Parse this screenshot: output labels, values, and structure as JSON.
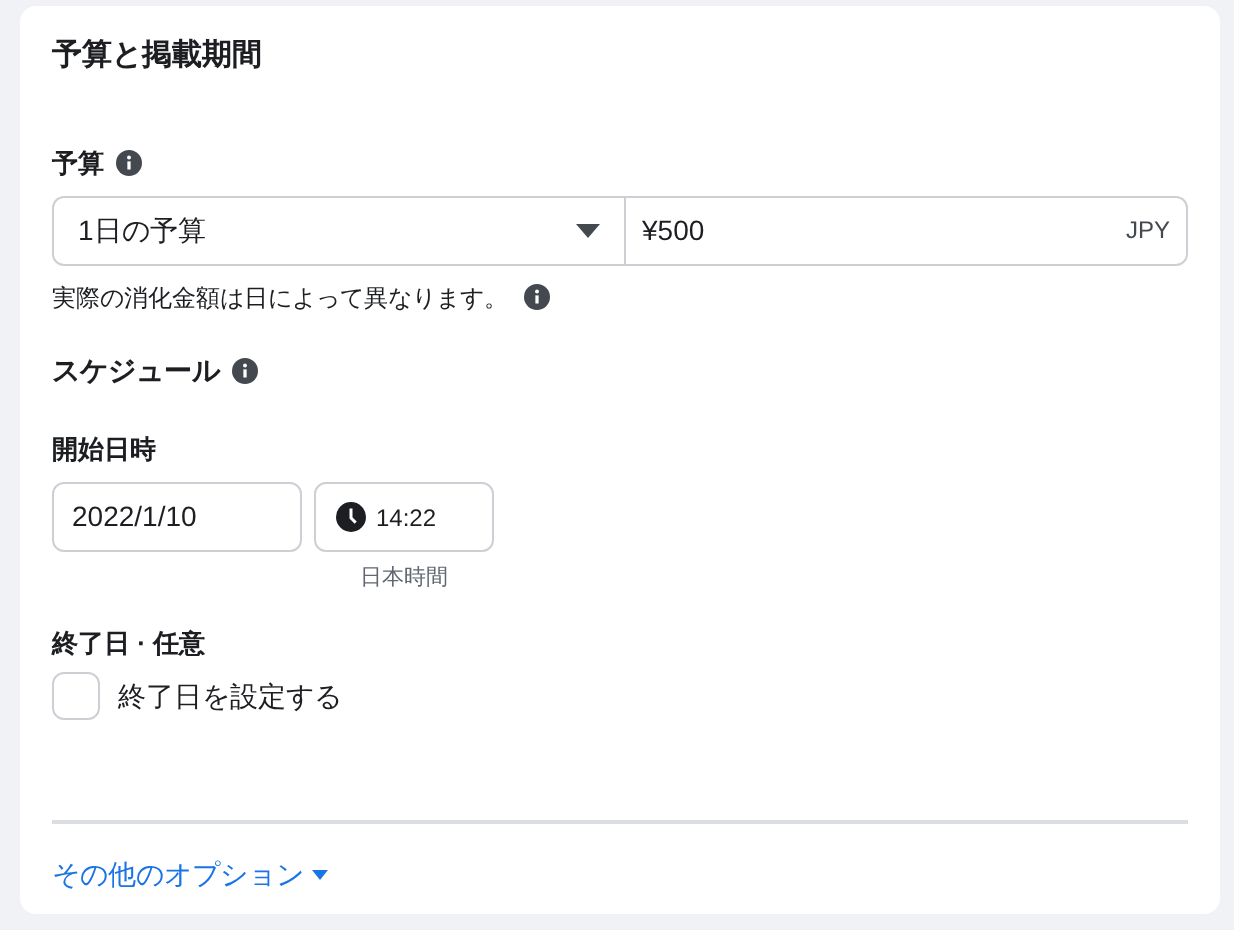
{
  "section": {
    "title": "予算と掲載期間"
  },
  "budget": {
    "label": "予算",
    "type": "1日の予算",
    "amount": "¥500",
    "currency": "JPY",
    "note": "実際の消化金額は日によって異なります。"
  },
  "schedule": {
    "label": "スケジュール",
    "start_label": "開始日時",
    "start_date": "2022/1/10",
    "start_time": "14:22",
    "timezone": "日本時間",
    "end_label": "終了日 · 任意",
    "end_checkbox": {
      "label": "終了日を設定する",
      "checked": false
    }
  },
  "more_options": {
    "label": "その他のオプション"
  }
}
